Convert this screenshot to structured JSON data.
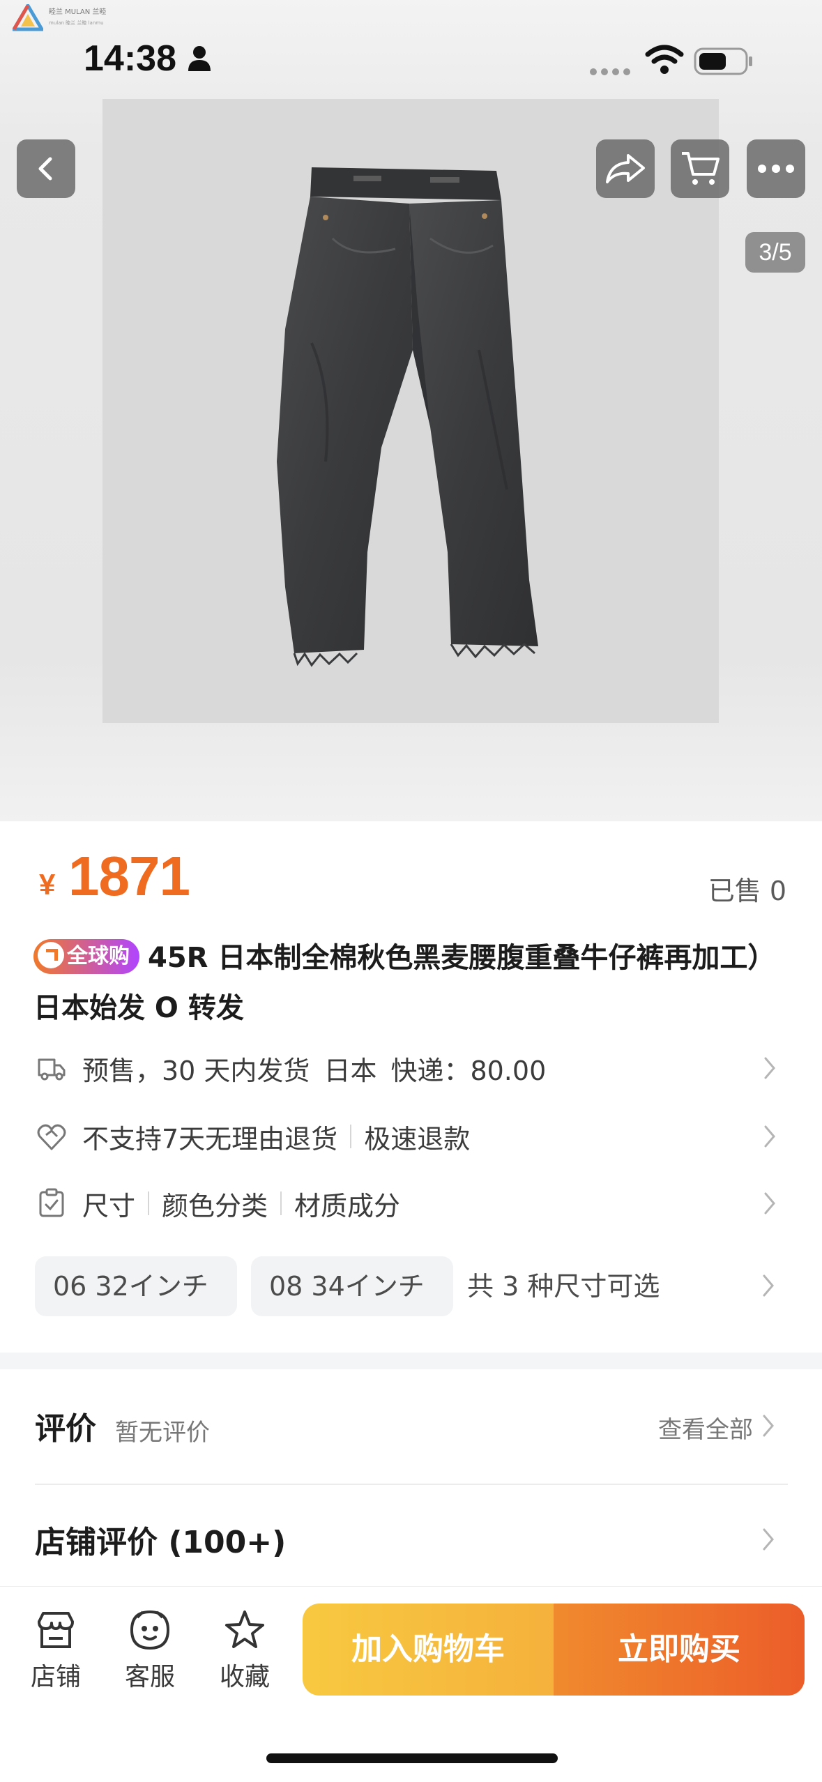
{
  "watermark": {
    "line1": "睦兰 MULAN 兰睦",
    "line2": "mulan 睦兰 兰睦 lanmu"
  },
  "status_bar": {
    "time": "14:38",
    "icons": [
      "person-icon",
      "signal-dots-icon",
      "wifi-icon",
      "battery-icon"
    ]
  },
  "nav": {
    "back_icon": "chevron-left-icon",
    "share_icon": "share-icon",
    "cart_icon": "cart-icon",
    "more_icon": "more-icon"
  },
  "gallery": {
    "counter": "3/5",
    "image_subject": "black denim jeans"
  },
  "product": {
    "currency": "¥",
    "price": "1871",
    "sold": "已售 0",
    "badge": "全球购",
    "title": "45R 日本制全棉秋色黑麦腰腹重叠牛仔裤再加工）日本始发 O 转发"
  },
  "shipping": {
    "parts": [
      "预售，30 天内发货",
      "日本",
      "快递：80.00"
    ]
  },
  "returns": {
    "parts": [
      "不支持7天无理由退货",
      "极速退款"
    ]
  },
  "attributes": {
    "parts": [
      "尺寸",
      "颜色分类",
      "材质成分"
    ]
  },
  "sizes": {
    "options": [
      "06 32インチ",
      "08 34インチ"
    ],
    "note": "共 3 种尺寸可选"
  },
  "reviews": {
    "title": "评价",
    "subtitle": "暂无评价",
    "view_all": "查看全部"
  },
  "shop_reviews": {
    "title": "店铺评价 (100+)"
  },
  "bottom_bar": {
    "tabs": [
      {
        "label": "店铺",
        "icon": "store-icon"
      },
      {
        "label": "客服",
        "icon": "customer-service-icon"
      },
      {
        "label": "收藏",
        "icon": "star-icon"
      }
    ],
    "add_to_cart": "加入购物车",
    "buy_now": "立即购买"
  },
  "colors": {
    "price": "#ef6b20",
    "cart_button": "#f8c940",
    "buy_button": "#ec5d29"
  }
}
